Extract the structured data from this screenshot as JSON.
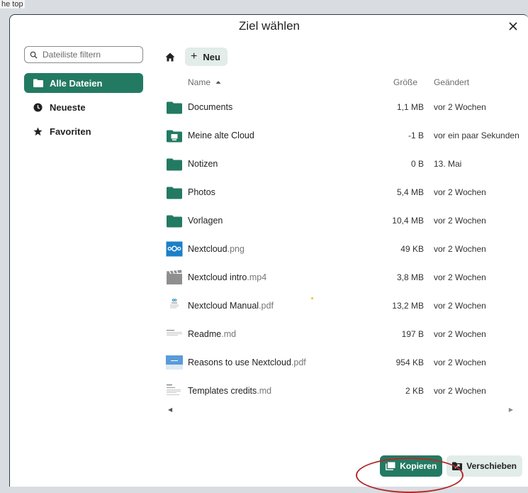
{
  "background": {
    "text": "he top"
  },
  "dialog": {
    "title": "Ziel wählen",
    "close_label": "×"
  },
  "sidebar": {
    "filter_placeholder": "Dateiliste filtern",
    "items": [
      {
        "label": "Alle Dateien",
        "icon": "folder-icon",
        "active": true
      },
      {
        "label": "Neueste",
        "icon": "clock-icon",
        "active": false
      },
      {
        "label": "Favoriten",
        "icon": "star-icon",
        "active": false
      }
    ]
  },
  "toolbar": {
    "new_label": "Neu"
  },
  "columns": {
    "name": "Name",
    "size": "Größe",
    "modified": "Geändert"
  },
  "files": [
    {
      "name": "Documents",
      "ext": "",
      "size": "1,1 MB",
      "modified": "vor 2 Wochen",
      "icon": "folder-icon"
    },
    {
      "name": "Meine alte Cloud",
      "ext": "",
      "size": "-1 B",
      "modified": "vor ein paar Sekunden",
      "icon": "external-storage-folder-icon"
    },
    {
      "name": "Notizen",
      "ext": "",
      "size": "0 B",
      "modified": "13. Mai",
      "icon": "folder-icon"
    },
    {
      "name": "Photos",
      "ext": "",
      "size": "5,4 MB",
      "modified": "vor 2 Wochen",
      "icon": "folder-icon"
    },
    {
      "name": "Vorlagen",
      "ext": "",
      "size": "10,4 MB",
      "modified": "vor 2 Wochen",
      "icon": "folder-icon"
    },
    {
      "name": "Nextcloud",
      "ext": ".png",
      "size": "49 KB",
      "modified": "vor 2 Wochen",
      "icon": "nextcloud-image-icon"
    },
    {
      "name": "Nextcloud intro",
      "ext": ".mp4",
      "size": "3,8 MB",
      "modified": "vor 2 Wochen",
      "icon": "video-icon"
    },
    {
      "name": "Nextcloud Manual",
      "ext": ".pdf",
      "size": "13,2 MB",
      "modified": "vor 2 Wochen",
      "icon": "pdf-thumbnail-icon"
    },
    {
      "name": "Readme",
      "ext": ".md",
      "size": "197 B",
      "modified": "vor 2 Wochen",
      "icon": "text-document-icon"
    },
    {
      "name": "Reasons to use Nextcloud",
      "ext": ".pdf",
      "size": "954 KB",
      "modified": "vor 2 Wochen",
      "icon": "pdf-preview-icon"
    },
    {
      "name": "Templates credits",
      "ext": ".md",
      "size": "2 KB",
      "modified": "vor 2 Wochen",
      "icon": "text-document-icon"
    }
  ],
  "actions": {
    "copy_label": "Kopieren",
    "move_label": "Verschieben"
  },
  "colors": {
    "accent": "#237a62",
    "accent_light": "#e2ece9",
    "folder": "#237a62",
    "highlight": "#b22a2a"
  }
}
